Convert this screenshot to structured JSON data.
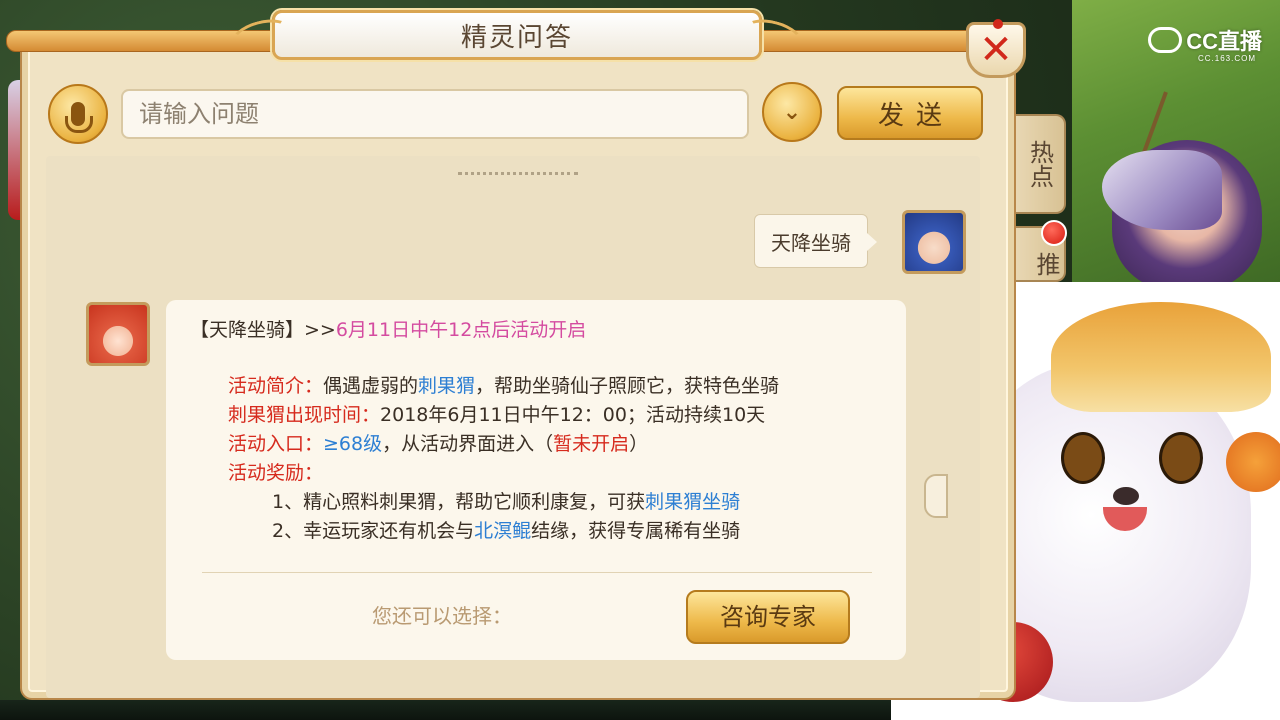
{
  "dialog": {
    "title": "精灵问答",
    "close_label": "✕"
  },
  "input": {
    "placeholder": "请输入问题",
    "send_label": "发送"
  },
  "side_tabs": [
    {
      "label": "热点"
    },
    {
      "label": "推"
    }
  ],
  "chat": {
    "user_message": "天降坐骑",
    "answer": {
      "heading_prefix": "【天降坐骑】>>",
      "heading_highlight": "6月11日中午12点后活动开启",
      "intro_label": "活动简介：",
      "intro_text_1": "偶遇虚弱的",
      "intro_link": "刺果猬",
      "intro_text_2": "，帮助坐骑仙子照顾它，获特色坐骑",
      "time_label": "刺果猬出现时间：",
      "time_text": "2018年6月11日中午12：00；活动持续10天",
      "entry_label": "活动入口：",
      "entry_level": "≥68级",
      "entry_text": "，从活动界面进入（",
      "entry_status": "暂未开启",
      "entry_close": "）",
      "reward_label": "活动奖励：",
      "reward_1_text": "1、精心照料刺果猬，帮助它顺利康复，可获",
      "reward_1_link": "刺果猬坐骑",
      "reward_2_text_1": "2、幸运玩家还有机会与",
      "reward_2_link": "北溟鲲",
      "reward_2_text_2": "结缘，获得专属稀有坐骑",
      "choose_prompt": "您还可以选择：",
      "consult_label": "咨询专家"
    }
  },
  "overlay": {
    "logo_text": "CC直播",
    "logo_sub": "CC.163.COM"
  },
  "colors": {
    "accent_gold": "#eeb94a",
    "link_blue": "#2d7fd3",
    "highlight_pink": "#d44ba0",
    "label_red": "#d62a1d",
    "close_red": "#d1281b"
  }
}
